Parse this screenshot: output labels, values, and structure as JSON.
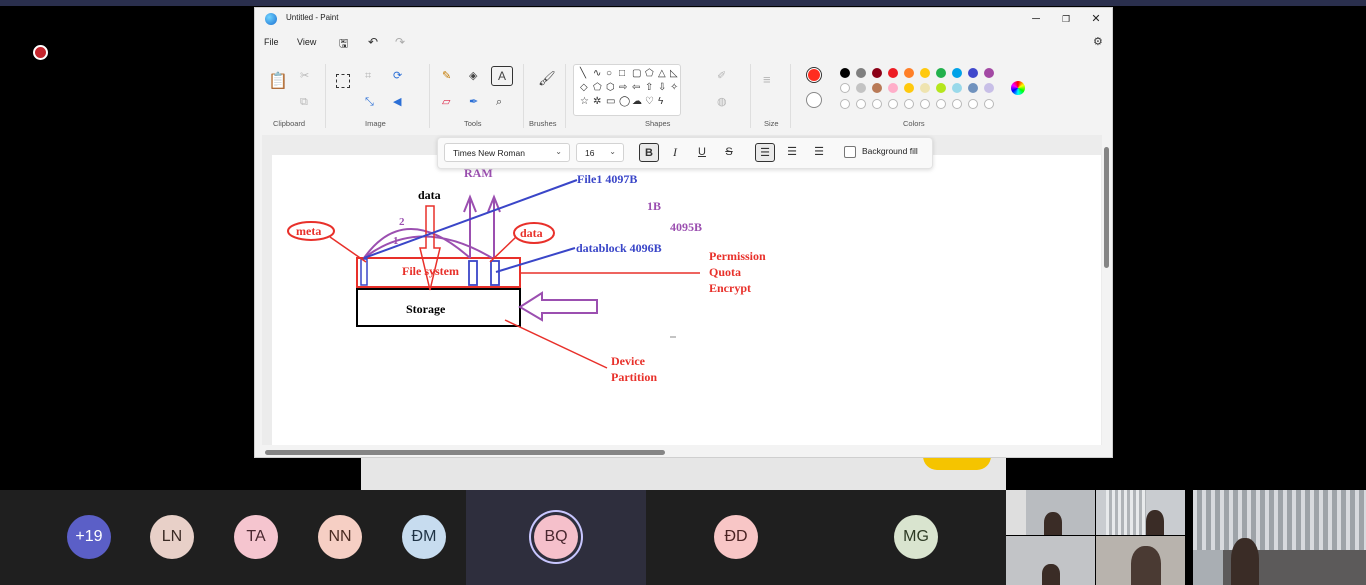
{
  "window": {
    "title": "Untitled - Paint",
    "minimize": "─",
    "maximize": "❐",
    "close": "✕"
  },
  "menu": {
    "file": "File",
    "view": "View"
  },
  "ribbon_groups": {
    "clipboard": "Clipboard",
    "image": "Image",
    "tools": "Tools",
    "brushes": "Brushes",
    "shapes": "Shapes",
    "size": "Size",
    "colors": "Colors"
  },
  "text_toolbar": {
    "font": "Times New Roman",
    "size": "16",
    "bold": "B",
    "italic": "I",
    "underline": "U",
    "strike": "S",
    "background_fill": "Background fill"
  },
  "colors": {
    "primary": "#ff2d20",
    "row1": [
      "#000000",
      "#7f7f7f",
      "#8b0016",
      "#ed1c24",
      "#ff7f27",
      "#ffc90e",
      "#22b14c",
      "#00a2e8",
      "#3f48cc",
      "#a349a4"
    ],
    "row2": [
      "#ffffff",
      "#c3c3c3",
      "#b97a57",
      "#ffaec9",
      "#ffc90e",
      "#efe4b0",
      "#b5e61d",
      "#99d9ea",
      "#7092be",
      "#c8bfe7"
    ]
  },
  "drawing": {
    "meta": "meta",
    "data_left": "data",
    "data_right": "data",
    "ram": "RAM",
    "file1": "File1 4097B",
    "one_b": "1B",
    "b4095": "4095B",
    "datablock": "datablock  4096B",
    "n1": "1",
    "n2": "2",
    "filesystem": "File system",
    "storage": "Storage",
    "permission": "Permission",
    "quota": "Quota",
    "encrypt": "Encrypt",
    "device": "Device",
    "partition": "Partition"
  },
  "participants": [
    {
      "initials": "+19",
      "bg": "#5b5fc7",
      "fg": "#ffffff"
    },
    {
      "initials": "LN",
      "bg": "#e8d0c8",
      "fg": "#3a2a24"
    },
    {
      "initials": "TA",
      "bg": "#f5c5cf",
      "fg": "#4a2830"
    },
    {
      "initials": "NN",
      "bg": "#f6cfc4",
      "fg": "#4a2c22"
    },
    {
      "initials": "ĐM",
      "bg": "#c7dcef",
      "fg": "#1f3346"
    },
    {
      "initials": "BQ",
      "bg": "#f5c0cb",
      "fg": "#4a2830"
    },
    {
      "initials": "ĐD",
      "bg": "#f8c6c6",
      "fg": "#4a2222"
    },
    {
      "initials": "MG",
      "bg": "#d9e4cf",
      "fg": "#2d3a24"
    }
  ]
}
